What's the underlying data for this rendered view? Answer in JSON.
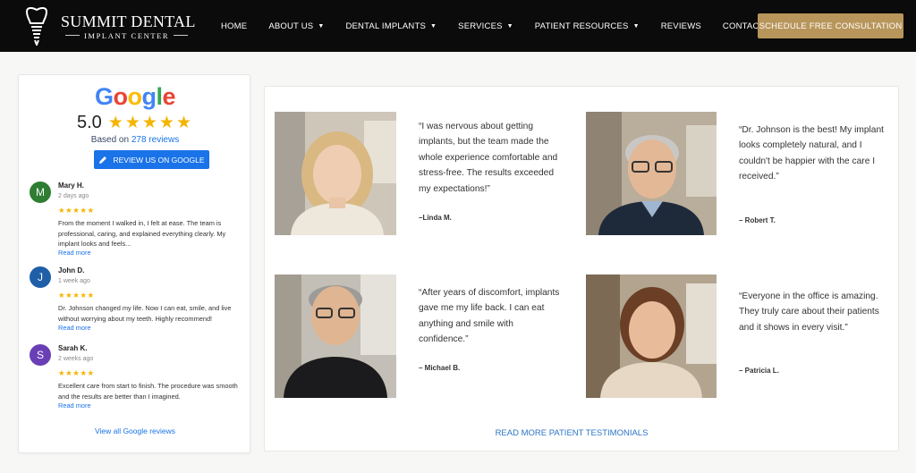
{
  "header": {
    "logo_title": "SUMMIT DENTAL",
    "logo_subtitle": "IMPLANT CENTER",
    "nav": [
      {
        "label": "HOME",
        "has_dropdown": false
      },
      {
        "label": "ABOUT US",
        "has_dropdown": true
      },
      {
        "label": "DENTAL IMPLANTS",
        "has_dropdown": true
      },
      {
        "label": "SERVICES",
        "has_dropdown": true
      },
      {
        "label": "PATIENT RESOURCES",
        "has_dropdown": true
      },
      {
        "label": "REVIEWS",
        "has_dropdown": false
      },
      {
        "label": "CONTACT US",
        "has_dropdown": false
      }
    ],
    "cta_label": "SCHEDULE FREE CONSULTATION"
  },
  "google_card": {
    "logo_text": "Google",
    "rating": "5.0",
    "stars": 5,
    "based_on_prefix": "Based on ",
    "review_count": "278 reviews",
    "review_button": "REVIEW US ON GOOGLE",
    "reviews": [
      {
        "initial": "M",
        "name": "Mary H.",
        "time": "2 days ago",
        "stars": "★★★★★",
        "text": "From the moment I walked in, I felt at ease. The team is professional, caring, and explained everything clearly. My implant looks and feels...",
        "more": "Read more",
        "avatar_color": "#2e7d32"
      },
      {
        "initial": "J",
        "name": "John D.",
        "time": "1 week ago",
        "stars": "★★★★★",
        "text": "Dr. Johnson changed my life. Now I can eat, smile, and live without worrying about my teeth. Highly recommend!",
        "more": "Read more",
        "avatar_color": "#1e5fa8"
      },
      {
        "initial": "S",
        "name": "Sarah K.",
        "time": "2 weeks ago",
        "stars": "★★★★★",
        "text": "Excellent care from start to finish. The procedure was smooth and the results are better than I imagined.",
        "more": "Read more",
        "avatar_color": "#6a3fb5"
      }
    ],
    "view_all": "View all Google reviews"
  },
  "testimonials": {
    "items": [
      {
        "quote": "“I was nervous about getting implants, but the team made the whole experience comfortable and stress-free. The results exceeded my expectations!”",
        "author": "–Linda M."
      },
      {
        "quote": "“Dr. Johnson is the best! My implant looks completely natural, and I couldn't be happier with the care I received.”",
        "author": "– Robert T."
      },
      {
        "quote": "“After years of discomfort, implants gave me my life back. I can eat anything and smile with confidence.”",
        "author": "– Michael B."
      },
      {
        "quote": "“Everyone in the office is amazing. They truly care about their patients and it shows in every visit.”",
        "author": "– Patricia L."
      }
    ],
    "read_more": "READ MORE PATIENT TESTIMONIALS"
  },
  "colors": {
    "header_bg": "#0b0b0b",
    "cta_gold": "#b8955a",
    "google_blue": "#1a73e8",
    "star_gold": "#f5b400"
  }
}
